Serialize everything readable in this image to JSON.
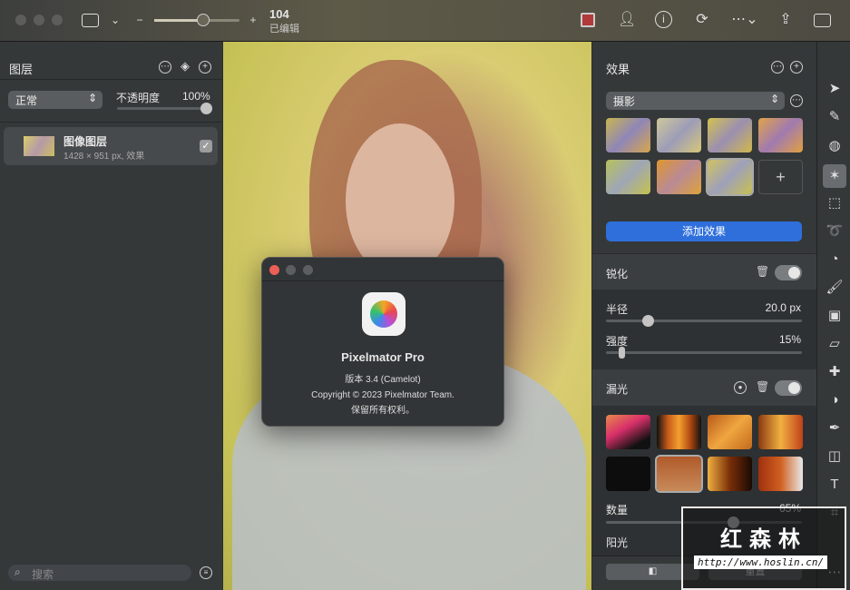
{
  "toolbar": {
    "zoom_value": "104",
    "status": "已编辑"
  },
  "layers": {
    "title": "图层",
    "blend_mode": "正常",
    "opacity_label": "不透明度",
    "opacity_value": "100%",
    "opacity": 1.0,
    "items": [
      {
        "name": "图像图层",
        "details": "1428 × 951 px, 效果",
        "visible": true
      }
    ],
    "search_placeholder": "搜索"
  },
  "about": {
    "app_name": "Pixelmator Pro",
    "version": "版本 3.4 (Camelot)",
    "copyright": "Copyright © 2023 Pixelmator Team.",
    "rights": "保留所有权利。"
  },
  "effects": {
    "title": "效果",
    "category": "摄影",
    "add_button": "添加效果",
    "sharpen": {
      "title": "锐化",
      "enabled": true,
      "radius_label": "半径",
      "radius_value": "20.0 px",
      "radius": 20,
      "intensity_label": "强度",
      "intensity_value": "15%",
      "intensity": 0.15
    },
    "light_leak": {
      "title": "漏光",
      "enabled": true,
      "amount_label": "数量",
      "amount_value": "65%",
      "amount": 0.65,
      "sunlight_label": "阳光"
    },
    "reset_label": "重置"
  },
  "watermark": {
    "text": "红森林",
    "url": "http://www.hoslin.cn/"
  },
  "colors": {
    "accent": "#2f6fdb",
    "panel": "#353839",
    "close": "#ec5f57"
  }
}
